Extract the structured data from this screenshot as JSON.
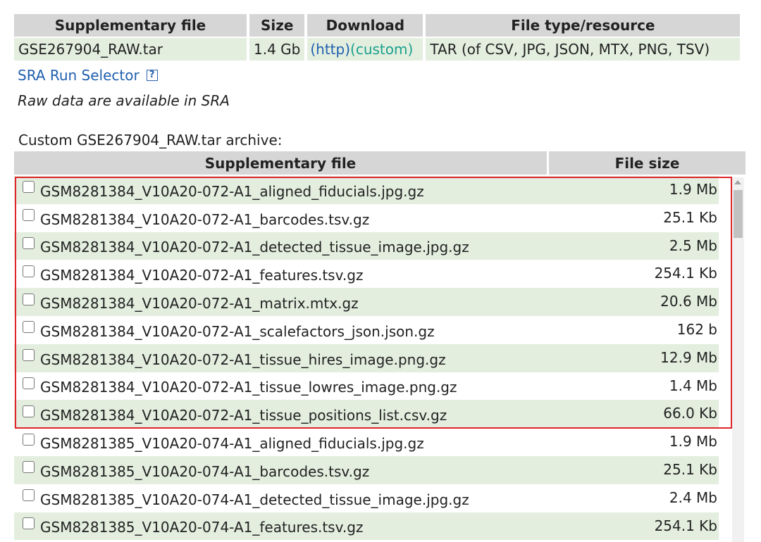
{
  "supplementary": {
    "headers": {
      "file": "Supplementary file",
      "size": "Size",
      "download": "Download",
      "type": "File type/resource"
    },
    "row": {
      "file": "GSE267904_RAW.tar",
      "size": "1.4 Gb",
      "http_link": "(http)",
      "custom_link": "(custom)",
      "type": "TAR (of CSV, JPG, JSON, MTX, PNG, TSV)"
    }
  },
  "sra": {
    "link": "SRA Run Selector",
    "help_icon": "help-icon",
    "note": "Raw data are available in SRA"
  },
  "archive": {
    "caption": "Custom GSE267904_RAW.tar archive:",
    "headers": {
      "file": "Supplementary file",
      "size": "File size"
    },
    "rows": [
      {
        "name": "GSM8281384_V10A20-072-A1_aligned_fiducials.jpg.gz",
        "size": "1.9 Mb"
      },
      {
        "name": "GSM8281384_V10A20-072-A1_barcodes.tsv.gz",
        "size": "25.1 Kb"
      },
      {
        "name": "GSM8281384_V10A20-072-A1_detected_tissue_image.jpg.gz",
        "size": "2.5 Mb"
      },
      {
        "name": "GSM8281384_V10A20-072-A1_features.tsv.gz",
        "size": "254.1 Kb"
      },
      {
        "name": "GSM8281384_V10A20-072-A1_matrix.mtx.gz",
        "size": "20.6 Mb"
      },
      {
        "name": "GSM8281384_V10A20-072-A1_scalefactors_json.json.gz",
        "size": "162 b"
      },
      {
        "name": "GSM8281384_V10A20-072-A1_tissue_hires_image.png.gz",
        "size": "12.9 Mb"
      },
      {
        "name": "GSM8281384_V10A20-072-A1_tissue_lowres_image.png.gz",
        "size": "1.4 Mb"
      },
      {
        "name": "GSM8281384_V10A20-072-A1_tissue_positions_list.csv.gz",
        "size": "66.0 Kb"
      },
      {
        "name": "GSM8281385_V10A20-074-A1_aligned_fiducials.jpg.gz",
        "size": "1.9 Mb"
      },
      {
        "name": "GSM8281385_V10A20-074-A1_barcodes.tsv.gz",
        "size": "25.1 Kb"
      },
      {
        "name": "GSM8281385_V10A20-074-A1_detected_tissue_image.jpg.gz",
        "size": "2.4 Mb"
      },
      {
        "name": "GSM8281385_V10A20-074-A1_features.tsv.gz",
        "size": "254.1 Kb"
      }
    ]
  },
  "colors": {
    "header_bg": "#d6d6d6",
    "row_green": "#e3eedf",
    "link_blue": "#1f5fae",
    "link_teal": "#1aa08c",
    "highlight_red": "#e0252b"
  }
}
